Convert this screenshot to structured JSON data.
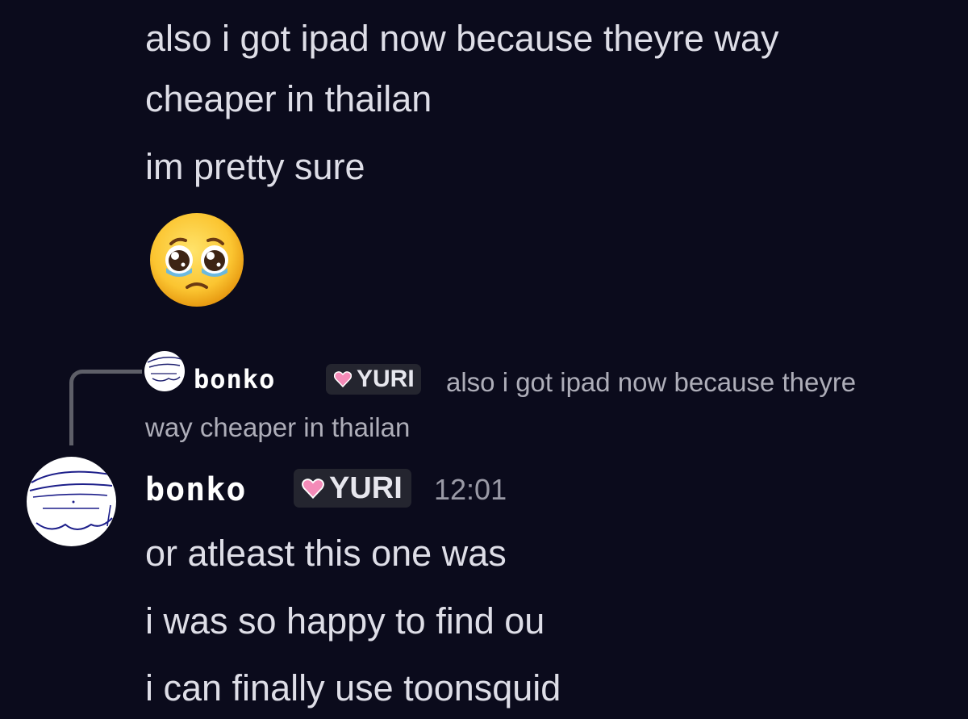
{
  "earlier_message": {
    "lines": [
      "also i got ipad now because theyre way",
      "cheaper in thailan",
      "im pretty sure"
    ],
    "emoji": "pleading-face"
  },
  "reply": {
    "author": "bonko",
    "role": "YURI",
    "preview_line1": "also i got ipad now because theyre",
    "preview_line2": "way cheaper in thailan"
  },
  "message": {
    "author": "bonko",
    "role": "YURI",
    "timestamp": "12:01",
    "lines": [
      "or atleast this one was",
      "i was so happy to find ou",
      "i can finally use toonsquid"
    ]
  },
  "colors": {
    "background": "#0b0b1c",
    "text": "#dedee7",
    "muted": "#aeaeb9",
    "tag_background": "#24252f",
    "heart": "#f48bb8"
  },
  "icons": {
    "avatar": "scribble-avatar",
    "role_icon": "pink-heart-icon"
  }
}
